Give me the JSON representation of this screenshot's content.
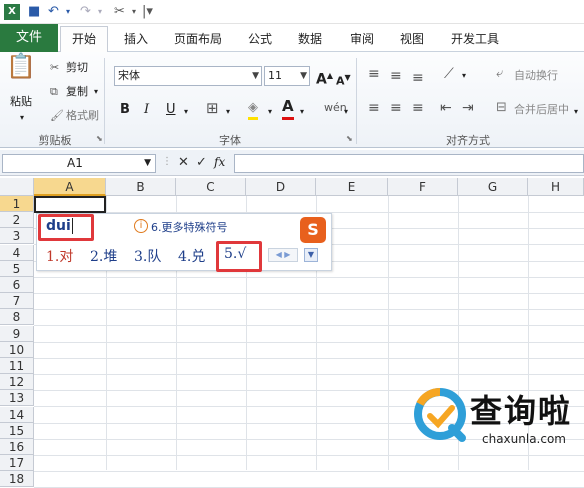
{
  "qat": {
    "icons": [
      "excel-icon",
      "save-icon",
      "undo-icon",
      "redo-icon",
      "tool-icon",
      "customize-icon"
    ]
  },
  "tabs": [
    "文件",
    "开始",
    "插入",
    "页面布局",
    "公式",
    "数据",
    "审阅",
    "视图",
    "开发工具"
  ],
  "clipboard": {
    "paste": "粘贴",
    "cut": "剪切",
    "copy": "复制",
    "format_painter": "格式刷",
    "group": "剪贴板"
  },
  "font": {
    "name": "宋体",
    "size": "11",
    "bold": "B",
    "italic": "I",
    "underline": "U",
    "group": "字体",
    "grow": "A",
    "shrink": "A"
  },
  "alignment": {
    "wrap": "自动换行",
    "merge": "合并后居中",
    "group": "对齐方式"
  },
  "formula": {
    "name_box": "A1",
    "fx": "fx",
    "x": "✕",
    "check": "✓"
  },
  "columns": [
    "A",
    "B",
    "C",
    "D",
    "E",
    "F",
    "G",
    "H"
  ],
  "rows": [
    "1",
    "2",
    "3",
    "4",
    "5",
    "6",
    "7",
    "8",
    "9",
    "10",
    "11",
    "12",
    "13",
    "14",
    "15",
    "16",
    "17",
    "18"
  ],
  "ime": {
    "input": "dui",
    "more_symbols": "6.更多特殊符号",
    "candidates": [
      {
        "num": "1.",
        "text": "对"
      },
      {
        "num": "2.",
        "text": "堆"
      },
      {
        "num": "3.",
        "text": "队"
      },
      {
        "num": "4.",
        "text": "兑"
      },
      {
        "num": "5.",
        "text": "√"
      }
    ],
    "logo": "S"
  },
  "watermark": {
    "brand": "查询啦",
    "url": "chaxunla.com"
  },
  "colors": {
    "file_tab": "#2a7a3f",
    "highlight": "#e0383b",
    "select_col": "#f7d88f"
  }
}
